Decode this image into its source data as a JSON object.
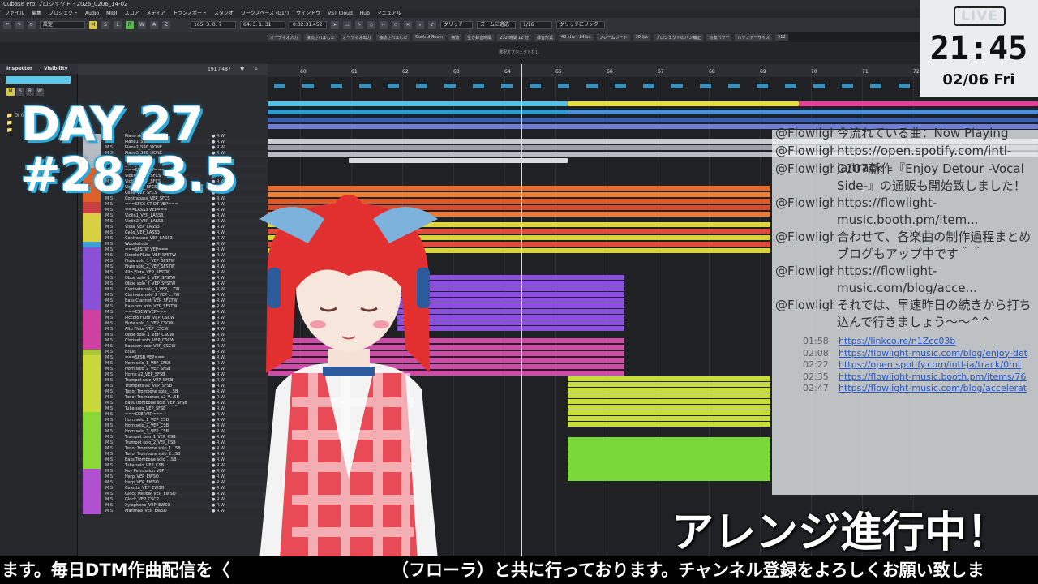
{
  "window": {
    "title": "Cubase Pro プロジェクト - 2026_0206_14-02"
  },
  "menu": [
    "ファイル",
    "編集",
    "プロジェクト",
    "Audio",
    "MIDI",
    "スコア",
    "メディア",
    "トランスポート",
    "スタジオ",
    "ワークスペース (G1°)",
    "ウィンドウ",
    "VST Cloud",
    "Hub",
    "マニュアル"
  ],
  "toolbar": {
    "preset": "設定",
    "buttons": [
      "M",
      "S",
      "R",
      "W",
      "A",
      "Z"
    ],
    "pos1": "165. 3. 0. 7",
    "pos2": "64. 3. 1. 31",
    "time": "0:02:31.452",
    "grid": "グリッド",
    "zoom": "ズームに適応",
    "quant": "1/16",
    "link": "グリッドにリンク"
  },
  "status": {
    "items": [
      "オーディオ入力",
      "接続されました",
      "オーディオ出力",
      "接続されました",
      "Control Room",
      "無効",
      "空き録音時間",
      "232 時間 12 分",
      "録音形式",
      "48 kHz - 24 bit",
      "フレームレート",
      "30 fps",
      "プロジェクトのパン補正",
      "均衡パワー",
      "バッファーサイズ",
      "512"
    ]
  },
  "infobar": {
    "text": "選択オブジェクトなし"
  },
  "inspector": {
    "tab1": "Inspector",
    "tab2": "Visibility",
    "track": "BGM",
    "sub": "DI 01"
  },
  "tracklist": {
    "counter": "191 / 487",
    "rows": [
      {
        "name": "Piano sketch",
        "color": "#b8bcc4"
      },
      {
        "name": "Piano1_S90_HONE",
        "color": "#b8bcc4"
      },
      {
        "name": "Piano2_S90_HONE",
        "color": "#b8bcc4"
      },
      {
        "name": "Piano3_S90_HONE",
        "color": "#b8bcc4"
      },
      {
        "name": "S90_HONE",
        "color": "#b8bcc4"
      },
      {
        "name": "_S90_HONE",
        "color": "#b8bcc4"
      },
      {
        "name": "===SFCS VEP===",
        "color": "#e0602a"
      },
      {
        "name": "Violin1_VEP_SFCS",
        "color": "#e0602a"
      },
      {
        "name": "Violin2_VEP_SFCS",
        "color": "#e0602a"
      },
      {
        "name": "Viola_VEP_SFCS",
        "color": "#e0602a"
      },
      {
        "name": "Cello_VEP_SFCS",
        "color": "#e0602a"
      },
      {
        "name": "Contrabass_VEP_SFCS",
        "color": "#e0602a"
      },
      {
        "name": "===SFCS CT DT VEP===",
        "color": "#c84040"
      },
      {
        "name": "===LASS3 VEP===",
        "color": "#c84040"
      },
      {
        "name": "Violin1_VEP_LASS3",
        "color": "#d8d040"
      },
      {
        "name": "Violin2_VEP_LASS3",
        "color": "#d8d040"
      },
      {
        "name": "Viola_VEP_LASS3",
        "color": "#d8d040"
      },
      {
        "name": "Cello_VEP_LASS3",
        "color": "#d8d040"
      },
      {
        "name": "Contrabass_VEP_LASS3",
        "color": "#d8d040"
      },
      {
        "name": "Woodwinds",
        "color": "#3aa0d8"
      },
      {
        "name": "===SFSTW VEP===",
        "color": "#8a50d8"
      },
      {
        "name": "Piccolo Flute_VEP_SFSTW",
        "color": "#8a50d8"
      },
      {
        "name": "Flute solo_1_VEP_SFSTW",
        "color": "#8a50d8"
      },
      {
        "name": "Flute solo_2_VEP_SFSTW",
        "color": "#8a50d8"
      },
      {
        "name": "Alto Flute_VEP_SFSTW",
        "color": "#8a50d8"
      },
      {
        "name": "Oboe solo_1_VEP_SFSTW",
        "color": "#8a50d8"
      },
      {
        "name": "Oboe solo_2_VEP_SFSTW",
        "color": "#8a50d8"
      },
      {
        "name": "Clarinete solo_1_VEP_...TW",
        "color": "#8a50d8"
      },
      {
        "name": "Clarinete solo_2_VEP_...TW",
        "color": "#8a50d8"
      },
      {
        "name": "Bass Clarinet_VEP_SFSTW",
        "color": "#8a50d8"
      },
      {
        "name": "Bassoon solo_VEP_SFSTW",
        "color": "#8a50d8"
      },
      {
        "name": "===CSCW VEP===",
        "color": "#d040a0"
      },
      {
        "name": "Piccolo Flute_VEP_CSCW",
        "color": "#d040a0"
      },
      {
        "name": "Flute solo_1_VEP_CSCW",
        "color": "#d040a0"
      },
      {
        "name": "Alto Flute_VEP_CSCW",
        "color": "#d040a0"
      },
      {
        "name": "Oboe solo_1_VEP_CSCW",
        "color": "#d040a0"
      },
      {
        "name": "Clarinet solo_VEP_CSCW",
        "color": "#d040a0"
      },
      {
        "name": "Bassoon solo_VEP_CSCW",
        "color": "#d040a0"
      },
      {
        "name": "Brass",
        "color": "#a8c838"
      },
      {
        "name": "===SFSB VEP===",
        "color": "#c8d838"
      },
      {
        "name": "Horn solo_1_VEP_SFSB",
        "color": "#c8d838"
      },
      {
        "name": "Horn solo_2_VEP_SFSB",
        "color": "#c8d838"
      },
      {
        "name": "Horns a2_VEP_SFSB",
        "color": "#c8d838"
      },
      {
        "name": "Trumpet solo_VEP_SFSB",
        "color": "#c8d838"
      },
      {
        "name": "Trumpets a2_VEP_SFSB",
        "color": "#c8d838"
      },
      {
        "name": "Tenor Trombone solo_...SB",
        "color": "#c8d838"
      },
      {
        "name": "Tenor Trombones a2_V...SB",
        "color": "#c8d838"
      },
      {
        "name": "Bass Trombone solo_VEP_SFSB",
        "color": "#c8d838"
      },
      {
        "name": "Tuba solo_VEP_SFSB",
        "color": "#c8d838"
      },
      {
        "name": "===CSB VEP===",
        "color": "#8ad838"
      },
      {
        "name": "Horn solo_1_VEP_CSB",
        "color": "#8ad838"
      },
      {
        "name": "Horn solo_2_VEP_CSB",
        "color": "#8ad838"
      },
      {
        "name": "Horn solo_3_VEP_CSB",
        "color": "#8ad838"
      },
      {
        "name": "Trumpet solo_1_VEP_CSB",
        "color": "#8ad838"
      },
      {
        "name": "Trumpet solo_2_VEP_CSB",
        "color": "#8ad838"
      },
      {
        "name": "Tenor Trombone solo_1...SB",
        "color": "#8ad838"
      },
      {
        "name": "Tenor Trombone solo_2...SB",
        "color": "#8ad838"
      },
      {
        "name": "Bass Trombone solo_...SB",
        "color": "#8ad838"
      },
      {
        "name": "Tuba solo_VEP_CSB",
        "color": "#8ad838"
      },
      {
        "name": "Key Percussion VEP",
        "color": "#b050d0"
      },
      {
        "name": "Harp_VEP_EWSO",
        "color": "#b050d0"
      },
      {
        "name": "Harp_VEP_EWSO",
        "color": "#b050d0"
      },
      {
        "name": "Celesta_VEP_EWSO",
        "color": "#b050d0"
      },
      {
        "name": "Glock Mellow_VEP_EWSO",
        "color": "#b050d0"
      },
      {
        "name": "Glock_VEP_CSCP",
        "color": "#b050d0"
      },
      {
        "name": "Xylophone_VEP_EWSO",
        "color": "#b050d0"
      },
      {
        "name": "Marimba_VEP_EWSO",
        "color": "#b050d0"
      }
    ]
  },
  "ruler": {
    "bars": [
      "60",
      "61",
      "62",
      "63",
      "64",
      "65",
      "66",
      "67",
      "68",
      "69",
      "70",
      "71",
      "72"
    ]
  },
  "chat": {
    "messages": [
      {
        "author": "@Flowlight",
        "text": "今流れている曲：Now Playing"
      },
      {
        "author": "@Flowlight",
        "text": "https://open.spotify.com/intl-ja/track"
      },
      {
        "author": "@Flowlight",
        "text": "C107新作『Enjoy Detour -Vocal Side-』の通販も開始致しました！"
      },
      {
        "author": "@Flowlight",
        "text": "https://flowlight-music.booth.pm/item..."
      },
      {
        "author": "@Flowlight",
        "text": "合わせて、各楽曲の制作過程まとめブログもアップ中です＾＾"
      },
      {
        "author": "@Flowlight",
        "text": "https://flowlight-music.com/blog/acce..."
      },
      {
        "author": "@Flowlight",
        "text": "それでは、早速昨日の続きから打ち込んで行きましょう〜〜^^"
      }
    ],
    "links": [
      {
        "time": "01:58",
        "url": "https://linkco.re/n1Zcc03b"
      },
      {
        "time": "02:08",
        "url": "https://flowlight-music.com/blog/enjoy-det"
      },
      {
        "time": "02:22",
        "url": "https://open.spotify.com/intl-ja/track/0mt"
      },
      {
        "time": "02:35",
        "url": "https://flowlight-music.booth.pm/items/76"
      },
      {
        "time": "02:47",
        "url": "https://flowlight-music.com/blog/accelerat"
      }
    ]
  },
  "clock": {
    "live": "LIVE",
    "time": "21:45",
    "date": "02/06 Fri"
  },
  "overlay": {
    "day": "DAY 27",
    "count": "#2873.5",
    "caption": "アレンジ進行中！",
    "ticker": "ます。毎日DTM作曲配信を〈　　　　　　　　　　（フローラ）と共に行っております。チャンネル登録をよろしくお願い致しま"
  },
  "colors": {
    "accent_cyan": "#5cc7e6",
    "record_green": "#52b84a",
    "yellow_btn": "#d8c64a"
  }
}
